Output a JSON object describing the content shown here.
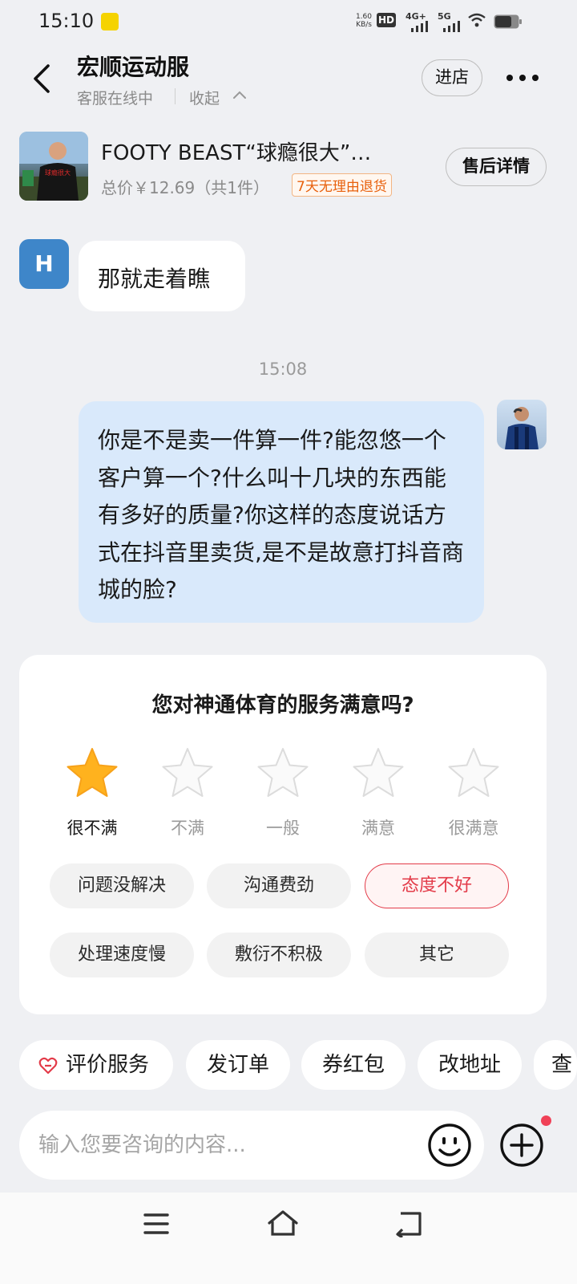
{
  "status_bar": {
    "time": "15:10",
    "net_speed_value": "1.60",
    "net_speed_unit": "KB/s",
    "hd_label": "HD",
    "network_1": "4G+",
    "network_2": "5G"
  },
  "header": {
    "shop_name": "宏顺运动服",
    "status": "客服在线中",
    "collapse_label": "收起",
    "enter_store_label": "进店"
  },
  "product": {
    "title": "FOOTY BEAST“球瘾很大”…",
    "price_text": "总价￥12.69（共1件）",
    "return_badge": "7天无理由退货",
    "aftersale_label": "售后详情",
    "shirt_text": "球瘾很大"
  },
  "chat": {
    "seller_avatar_letter": "H",
    "seller_message": "那就走着瞧",
    "time_divider": "15:08",
    "user_message": "你是不是卖一件算一件?能忽悠一个客户算一个?什么叫十几块的东西能有多好的质量?你这样的态度说话方式在抖音里卖货,是不是故意打抖音商城的脸?"
  },
  "rating": {
    "question": "您对神通体育的服务满意吗?",
    "selected_stars": 1,
    "star_labels": [
      "很不满",
      "不满",
      "一般",
      "满意",
      "很满意"
    ],
    "tags": [
      {
        "label": "问题没解决",
        "selected": false
      },
      {
        "label": "沟通费劲",
        "selected": false
      },
      {
        "label": "态度不好",
        "selected": true
      },
      {
        "label": "处理速度慢",
        "selected": false
      },
      {
        "label": "敷衍不积极",
        "selected": false
      },
      {
        "label": "其它",
        "selected": false
      }
    ],
    "colors": {
      "star_active": "#ffb21e",
      "tag_selected": "#e33b49"
    }
  },
  "quick_actions": [
    "评价服务",
    "发订单",
    "券红包",
    "改地址",
    "查"
  ],
  "input": {
    "placeholder": "输入您要咨询的内容..."
  },
  "icons": [
    "back-icon",
    "more-icon",
    "star-icon",
    "heart-icon",
    "emoji-icon",
    "plus-icon",
    "menu-icon",
    "home-icon",
    "return-icon"
  ]
}
